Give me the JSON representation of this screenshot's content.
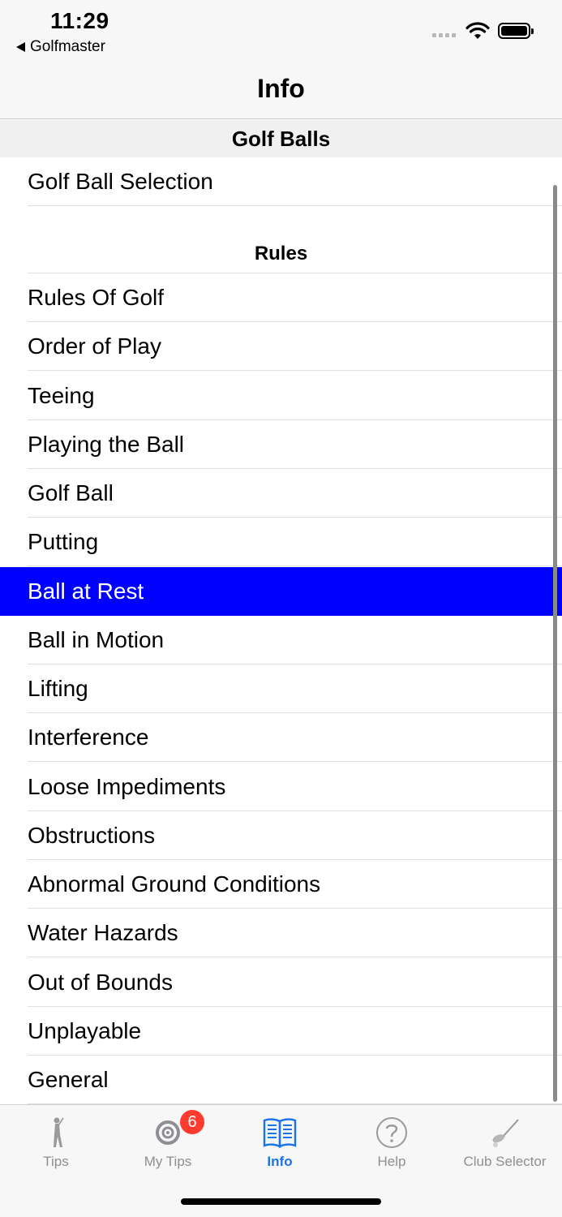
{
  "status": {
    "time": "11:29",
    "back_app": "Golfmaster"
  },
  "nav": {
    "title": "Info"
  },
  "sections": {
    "golf_balls": {
      "title": "Golf Balls",
      "items": [
        "Golf Ball Selection"
      ]
    },
    "rules": {
      "title": "Rules",
      "items": [
        "Rules Of Golf",
        "Order of Play",
        "Teeing",
        "Playing the Ball",
        "Golf Ball",
        "Putting",
        "Ball at Rest",
        "Ball in Motion",
        "Lifting",
        "Interference",
        "Loose Impediments",
        "Obstructions",
        "Abnormal Ground Conditions",
        "Water Hazards",
        "Out of Bounds",
        "Unplayable",
        "General"
      ],
      "selected": "Ball at Rest"
    }
  },
  "tabs": [
    {
      "label": "Tips",
      "icon": "golfer-icon"
    },
    {
      "label": "My Tips",
      "icon": "target-icon",
      "badge": "6"
    },
    {
      "label": "Info",
      "icon": "book-icon",
      "active": true
    },
    {
      "label": "Help",
      "icon": "question-icon"
    },
    {
      "label": "Club Selector",
      "icon": "golf-club-icon"
    }
  ],
  "colors": {
    "selected_row": "#0000ff",
    "active_tab": "#1a73e8",
    "badge": "#ff3b30"
  }
}
